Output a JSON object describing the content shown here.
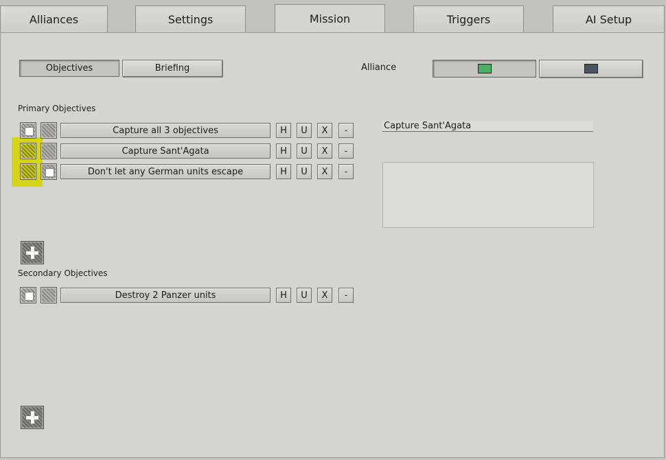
{
  "tabs": [
    {
      "label": "Alliances"
    },
    {
      "label": "Settings"
    },
    {
      "label": "Mission"
    },
    {
      "label": "Triggers"
    },
    {
      "label": "AI Setup"
    }
  ],
  "active_tab": "Mission",
  "subtabs": {
    "objectives": "Objectives",
    "briefing": "Briefing"
  },
  "alliance": {
    "label": "Alliance",
    "swatch_colors": [
      "#4caf62",
      "#4a5563"
    ]
  },
  "primary": {
    "title": "Primary Objectives",
    "items": [
      {
        "text": "Capture all 3 objectives"
      },
      {
        "text": "Capture Sant'Agata"
      },
      {
        "text": "Don't let any German units escape"
      }
    ]
  },
  "secondary": {
    "title": "Secondary Objectives",
    "items": [
      {
        "text": "Destroy 2 Panzer units"
      }
    ]
  },
  "row_buttons": {
    "h": "H",
    "u": "U",
    "x": "X",
    "minus": "-"
  },
  "detail": {
    "name_value": "Capture Sant'Agata",
    "description": ""
  },
  "colors": {
    "highlight": "#d4d40e",
    "panel": "#d6d4d0"
  }
}
